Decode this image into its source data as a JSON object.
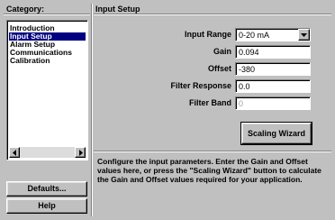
{
  "sidebar": {
    "header": "Category:",
    "items": [
      {
        "label": "Introduction",
        "selected": false
      },
      {
        "label": "Input Setup",
        "selected": true
      },
      {
        "label": "Alarm Setup",
        "selected": false
      },
      {
        "label": "Communications",
        "selected": false
      },
      {
        "label": "Calibration",
        "selected": false
      }
    ],
    "defaults_button": "Defaults...",
    "help_button": "Help"
  },
  "main": {
    "title": "Input Setup",
    "fields": {
      "input_range": {
        "label": "Input Range",
        "value": "0-20 mA"
      },
      "gain": {
        "label": "Gain",
        "value": "0.094"
      },
      "offset": {
        "label": "Offset",
        "value": "-380"
      },
      "filter_response": {
        "label": "Filter Response",
        "value": "0.0"
      },
      "filter_band": {
        "label": "Filter Band",
        "value": "0"
      }
    },
    "wizard_button": "Scaling Wizard",
    "help_text": "Configure the input parameters.  Enter the Gain and Offset values here, or press the \"Scaling Wizard\" button to calculate the Gain and Offset values required for your application."
  },
  "colors": {
    "face": "#c0c0c0",
    "selection": "#000080"
  }
}
